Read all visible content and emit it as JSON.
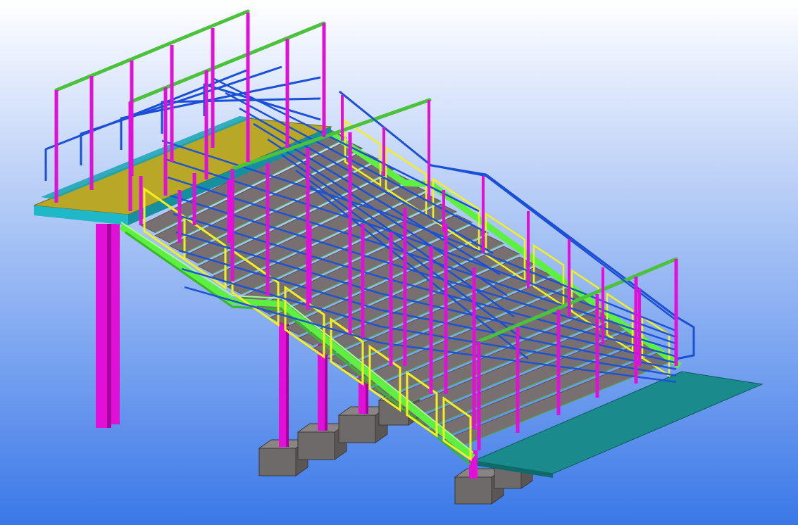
{
  "viewport": {
    "background_top": "#ffffff",
    "background_bottom": "#3a78e8"
  },
  "colors": {
    "column": "#e010d8",
    "column_dark": "#a8009f",
    "handrail_top": "#4cc23c",
    "handrail_mid": "#1a4fd6",
    "stringer": "#5ef040",
    "stringer_dark": "#36b82a",
    "panel_frame": "#f2f020",
    "tread": "#787070",
    "tread_edge": "#5a5454",
    "landing_plate": "#b8a826",
    "landing_edge": "#1fb8c8",
    "bottom_slab": "#1a8a8c",
    "footing_top": "#8a8484",
    "footing_side": "#5a5656",
    "footing_front": "#6e6a6a"
  },
  "model": {
    "objects": [
      "upper-landing",
      "landing-support-column",
      "stair-flight",
      "stringers",
      "handrails",
      "intermediate-support-columns",
      "concrete-footings",
      "bottom-slab"
    ]
  }
}
